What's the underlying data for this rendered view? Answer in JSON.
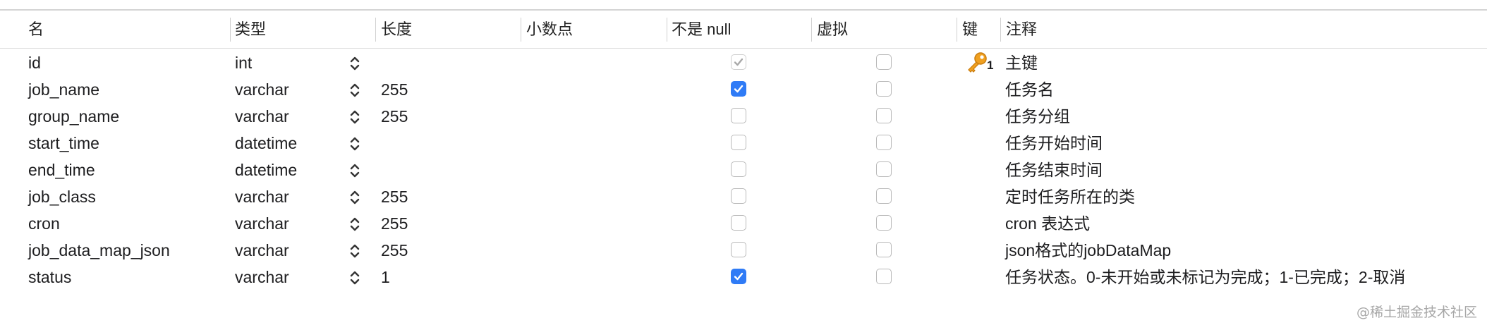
{
  "columns": [
    "名",
    "类型",
    "长度",
    "小数点",
    "不是 null",
    "虚拟",
    "键",
    "注释"
  ],
  "rows": [
    {
      "name": "id",
      "type": "int",
      "length": "",
      "not_null": "checked-dim",
      "virtual": false,
      "key": "1",
      "comment": "主键"
    },
    {
      "name": "job_name",
      "type": "varchar",
      "length": "255",
      "not_null": "checked",
      "virtual": false,
      "key": "",
      "comment": "任务名"
    },
    {
      "name": "group_name",
      "type": "varchar",
      "length": "255",
      "not_null": "unchecked",
      "virtual": false,
      "key": "",
      "comment": "任务分组"
    },
    {
      "name": "start_time",
      "type": "datetime",
      "length": "",
      "not_null": "unchecked",
      "virtual": false,
      "key": "",
      "comment": "任务开始时间"
    },
    {
      "name": "end_time",
      "type": "datetime",
      "length": "",
      "not_null": "unchecked",
      "virtual": false,
      "key": "",
      "comment": "任务结束时间"
    },
    {
      "name": "job_class",
      "type": "varchar",
      "length": "255",
      "not_null": "unchecked",
      "virtual": false,
      "key": "",
      "comment": "定时任务所在的类"
    },
    {
      "name": "cron",
      "type": "varchar",
      "length": "255",
      "not_null": "unchecked",
      "virtual": false,
      "key": "",
      "comment": "cron 表达式"
    },
    {
      "name": "job_data_map_json",
      "type": "varchar",
      "length": "255",
      "not_null": "unchecked",
      "virtual": false,
      "key": "",
      "comment": "json格式的jobDataMap"
    },
    {
      "name": "status",
      "type": "varchar",
      "length": "1",
      "not_null": "checked",
      "virtual": false,
      "key": "",
      "comment": "任务状态。0-未开始或未标记为完成；1-已完成；2-取消"
    }
  ],
  "watermark": "@稀土掘金技术社区",
  "colors": {
    "checkbox_accent": "#2f7bf6",
    "key_icon": "#f0a020"
  }
}
